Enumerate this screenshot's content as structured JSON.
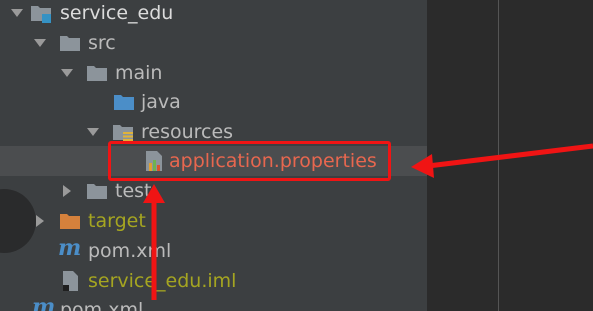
{
  "colors": {
    "tree_background": "#3c3f41",
    "editor_background": "#2b2b2b",
    "selected_row": "#4b4d4f",
    "default_text": "#bbbbbb",
    "project_title_text": "#dcdcdc",
    "properties_text": "#e8674f",
    "excluded_text": "#a5a521",
    "folder_gray": "#8c949b",
    "folder_blue": "#4b8ec8",
    "folder_orange": "#d5813c",
    "annotation_red": "#f01414"
  },
  "tree": {
    "project": {
      "label": "service_edu",
      "expanded": true
    },
    "src": {
      "label": "src",
      "expanded": true
    },
    "main": {
      "label": "main",
      "expanded": true
    },
    "java": {
      "label": "java"
    },
    "resources": {
      "label": "resources",
      "expanded": true
    },
    "application_properties": {
      "label": "application.properties",
      "selected": true
    },
    "test": {
      "label": "test",
      "expanded": false
    },
    "target": {
      "label": "target",
      "expanded": false
    },
    "pom_xml": {
      "label": "pom.xml"
    },
    "service_edu_iml": {
      "label": "service_edu.iml"
    },
    "parent_pom_xml": {
      "label": "pom.xml"
    }
  },
  "icons": {
    "expanded_arrow": "triangle-down",
    "collapsed_arrow": "triangle-right",
    "folder": "folder-icon",
    "module_folder": "module-folder-icon",
    "source_folder": "source-folder-icon",
    "resources_folder": "resources-folder-icon",
    "properties_file": "properties-file-icon",
    "maven_file": "maven-icon",
    "iml_file": "iml-file-icon"
  }
}
